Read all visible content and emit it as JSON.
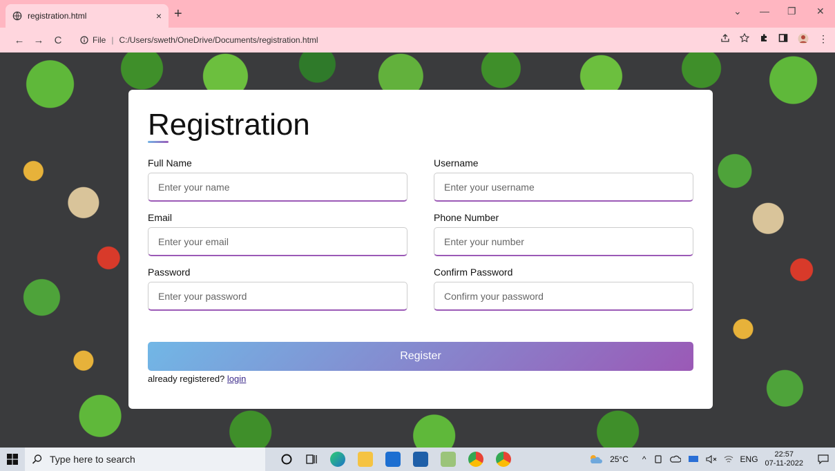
{
  "browser": {
    "tab_title": "registration.html",
    "tab_close": "×",
    "new_tab": "+",
    "url_scheme": "File",
    "url_path": "C:/Users/sweth/OneDrive/Documents/registration.html",
    "back": "←",
    "forward": "→",
    "reload": "C",
    "min": "—",
    "restore": "❐",
    "close": "✕",
    "chevron": "⌄",
    "menu": "⋮"
  },
  "form": {
    "title": "Registration",
    "fields": [
      {
        "label": "Full Name",
        "placeholder": "Enter your name"
      },
      {
        "label": "Username",
        "placeholder": "Enter your username"
      },
      {
        "label": "Email",
        "placeholder": "Enter your email"
      },
      {
        "label": "Phone Number",
        "placeholder": "Enter your number"
      },
      {
        "label": "Password",
        "placeholder": "Enter your password"
      },
      {
        "label": "Confirm Password",
        "placeholder": "Confirm your password"
      }
    ],
    "submit_label": "Register",
    "login_prompt": "already registered?",
    "login_link": "login"
  },
  "colors": {
    "gradient_start": "#71b7e6",
    "gradient_end": "#9b59b6",
    "tabbar": "#ffb6c1"
  },
  "taskbar": {
    "search_placeholder": "Type here to search",
    "weather": "25°C",
    "lang": "ENG",
    "time": "22:57",
    "date": "07-11-2022",
    "tray_chevron": "^"
  }
}
